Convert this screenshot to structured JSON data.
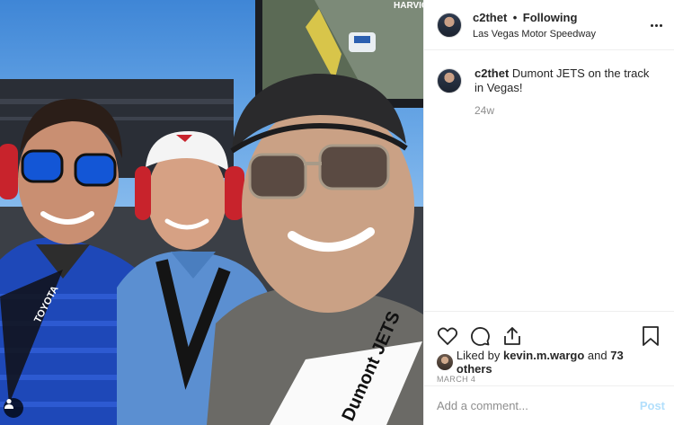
{
  "post": {
    "username": "c2thet",
    "separator": "•",
    "follow_status": "Following",
    "location": "Las Vegas Motor Speedway",
    "caption": "Dumont JETS on the track in Vegas!",
    "time_ago": "24w",
    "likes_prefix": "Liked by",
    "liked_by_user": "kevin.m.wargo",
    "likes_and": "and",
    "likes_others": "73 others",
    "date": "March 4"
  },
  "comment": {
    "placeholder": "Add a comment...",
    "post_label": "Post"
  },
  "photo": {
    "banner_text": "HARVIC",
    "lanyard_left": "TOYOTA",
    "lanyard_right": "Dumont JETS"
  },
  "icons": {
    "like": "heart-icon",
    "comment": "comment-icon",
    "share": "share-icon",
    "save": "bookmark-icon",
    "more": "more-options-icon",
    "user_tag": "user-tag-icon"
  },
  "colors": {
    "text": "#262626",
    "secondary": "#8e8e8e",
    "post_button_disabled": "#b2dffc",
    "border": "#efefef"
  }
}
